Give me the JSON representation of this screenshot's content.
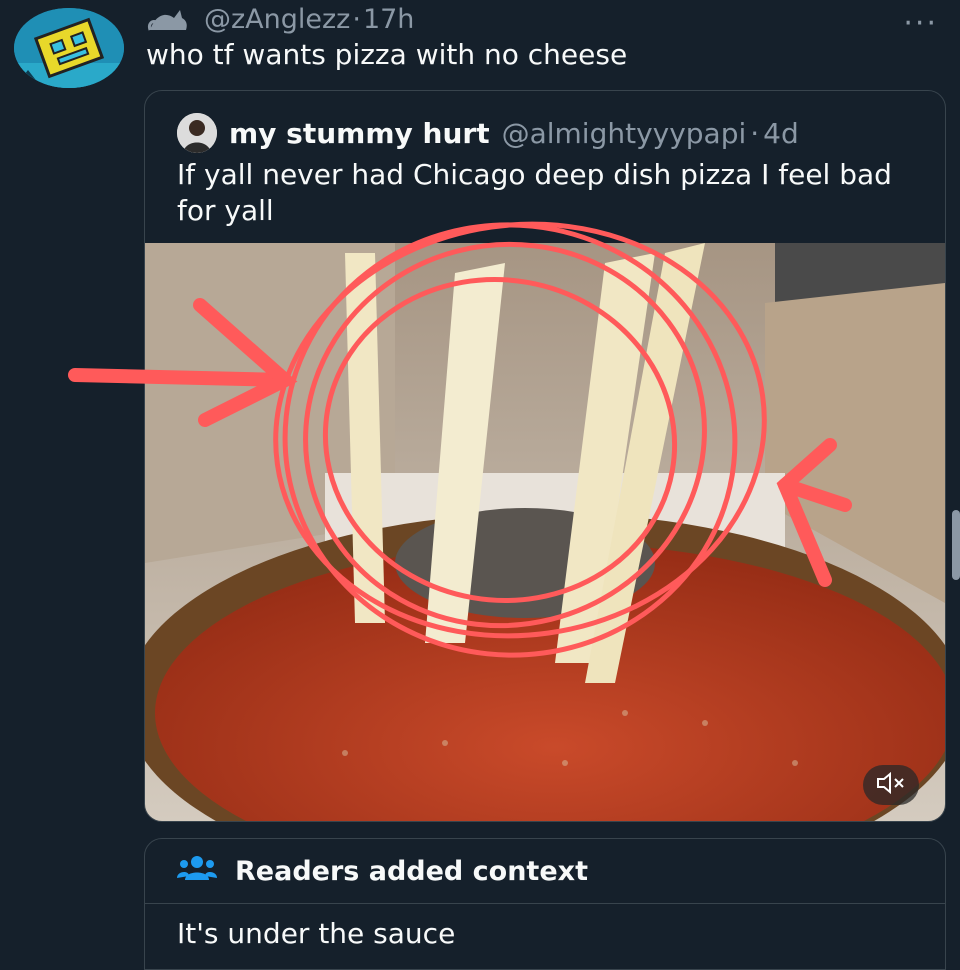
{
  "tweet": {
    "handle": "@zAnglezz",
    "separator": "·",
    "time": "17h",
    "text": "who tf wants pizza with no cheese",
    "more_icon": "more-horizontal-icon"
  },
  "quote": {
    "name": "my stummy hurt",
    "handle": "@almightyyypapi",
    "separator": "·",
    "time": "4d",
    "text": "If yall never had Chicago deep dish pizza I feel bad for yall",
    "media_description_icon": "video-media",
    "mute_icon": "speaker-muted-icon"
  },
  "context": {
    "icon": "people-icon",
    "heading": "Readers added context",
    "body": "It's under the sauce"
  },
  "colors": {
    "background": "#15202b",
    "annotation": "#ff5a5a",
    "accent": "#1d9bf0"
  }
}
